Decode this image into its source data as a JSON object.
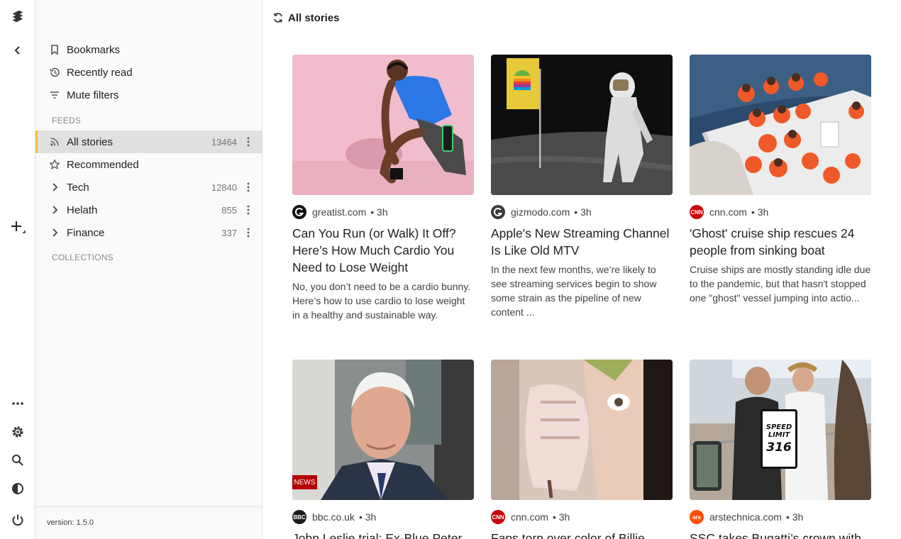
{
  "rail": {
    "logo_icon": "layers-icon",
    "collapse_icon": "chevron-left-icon",
    "add_feed_icon": "add-icon",
    "bottom_icons": [
      "more-horizontal-icon",
      "gear-icon",
      "search-icon",
      "contrast-icon",
      "power-icon"
    ]
  },
  "sidebar": {
    "top_items": [
      {
        "label": "Bookmarks",
        "icon": "bookmark-icon"
      },
      {
        "label": "Recently read",
        "icon": "history-icon"
      },
      {
        "label": "Mute filters",
        "icon": "filter-icon"
      }
    ],
    "feeds_header": "FEEDS",
    "feeds": [
      {
        "label": "All stories",
        "count": "13464",
        "icon": "rss-icon",
        "active": true
      },
      {
        "label": "Recommended",
        "count": "",
        "icon": "star-icon"
      },
      {
        "label": "Tech",
        "count": "12840",
        "icon": "chevron-right-icon"
      },
      {
        "label": "Helath",
        "count": "855",
        "icon": "chevron-right-icon"
      },
      {
        "label": "Finance",
        "count": "337",
        "icon": "chevron-right-icon"
      }
    ],
    "collections_header": "COLLECTIONS",
    "version": "version: 1.5.0"
  },
  "main": {
    "title": "All stories",
    "title_icon": "refresh-icon",
    "cards": [
      {
        "source": "greatist.com",
        "time": "3h",
        "title": "Can You Run (or Walk) It Off? Here’s How Much Cardio You Need to Lose Weight",
        "desc": "No, you don’t need to be a cardio bunny. Here’s how to use cardio to lose weight in a healthy and sustainable way.",
        "fav_color": "#111111",
        "fav_text": "G"
      },
      {
        "source": "gizmodo.com",
        "time": "3h",
        "title": "Apple's New Streaming Channel Is Like Old MTV",
        "desc": "In the next few months, we’re likely to see streaming services begin to show some strain as the pipeline of new content ...",
        "fav_color": "#3a3a3a",
        "fav_text": "G"
      },
      {
        "source": "cnn.com",
        "time": "3h",
        "title": "'Ghost' cruise ship rescues 24 people from sinking boat",
        "desc": "Cruise ships are mostly standing idle due to the pandemic, but that hasn't stopped one \"ghost\" vessel jumping into actio...",
        "fav_color": "#cc0000",
        "fav_text": "CNN"
      },
      {
        "source": "bbc.co.uk",
        "time": "3h",
        "title": "John Leslie trial: Ex-Blue Peter",
        "desc": "",
        "fav_color": "#1a1a1a",
        "fav_text": "BBC",
        "badge": "NEWS"
      },
      {
        "source": "cnn.com",
        "time": "3h",
        "title": "Fans torn over color of Billie",
        "desc": "",
        "fav_color": "#cc0000",
        "fav_text": "CNN"
      },
      {
        "source": "arstechnica.com",
        "time": "3h",
        "title": "SSC takes Bugatti’s crown with",
        "desc": "",
        "fav_color": "#ff4e00",
        "fav_text": "ars",
        "sign": [
          "SPEED",
          "LIMIT",
          "316"
        ]
      }
    ]
  }
}
